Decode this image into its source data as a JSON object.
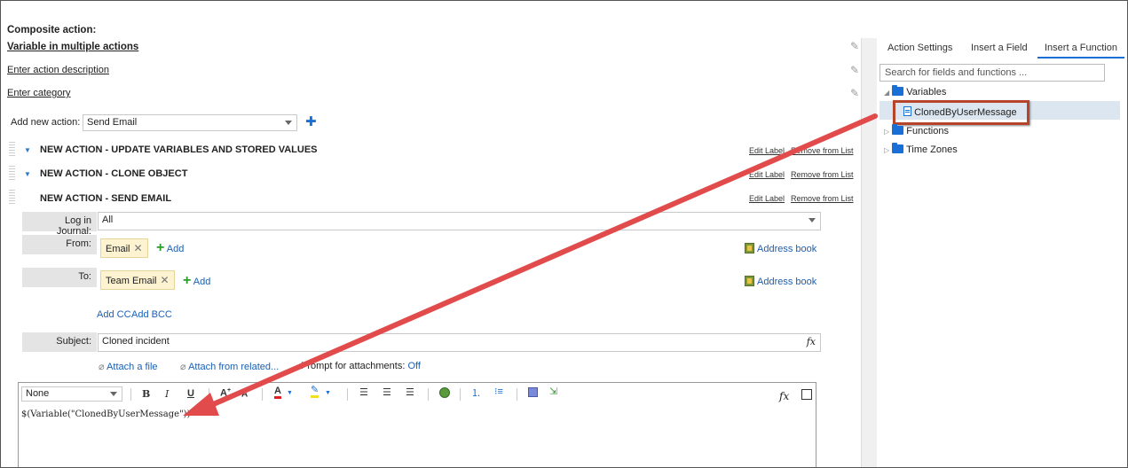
{
  "composite": {
    "title": "Composite action:",
    "name": "Variable in multiple actions",
    "description_placeholder": "Enter action description",
    "category_placeholder": "Enter category"
  },
  "add_new_action": {
    "label": "Add new action:",
    "selected": "Send Email"
  },
  "actions": [
    {
      "title": "NEW ACTION - UPDATE VARIABLES AND STORED VALUES",
      "edit_label": "Edit Label",
      "remove_label": "Remove from List"
    },
    {
      "title": "NEW ACTION - CLONE OBJECT",
      "edit_label": "Edit Label",
      "remove_label": "Remove from List"
    },
    {
      "title": "NEW ACTION - SEND EMAIL",
      "edit_label": "Edit Label",
      "remove_label": "Remove from List"
    }
  ],
  "send_email": {
    "log_label": "Log in Journal:",
    "log_value": "All",
    "from_label": "From:",
    "from_tag": "Email",
    "to_label": "To:",
    "to_tag": "Team Email",
    "add_label": "Add",
    "address_book": "Address book",
    "add_cc": "Add CC",
    "add_bcc": "Add BCC",
    "subject_label": "Subject:",
    "subject_value": "Cloned incident",
    "attach_file": "Attach a file",
    "attach_related": "Attach from related...",
    "prompt_label": "Prompt for attachments:",
    "prompt_value": "Off"
  },
  "editor": {
    "format_value": "None",
    "content": "$(Variable(\"ClonedByUserMessage\"))"
  },
  "right_panel": {
    "tabs": [
      "Action Settings",
      "Insert a Field",
      "Insert a Function"
    ],
    "active_tab": "Insert a Function",
    "search_placeholder": "Search for fields and functions ...",
    "tree": {
      "variables": "Variables",
      "variable_item": "ClonedByUserMessage",
      "functions": "Functions",
      "time_zones": "Time Zones"
    }
  },
  "colors": {
    "accent": "#1a6fd6",
    "highlight_box": "#b5442b",
    "arrow": "#e24b4b",
    "tag_bg": "#fdf3d0"
  }
}
